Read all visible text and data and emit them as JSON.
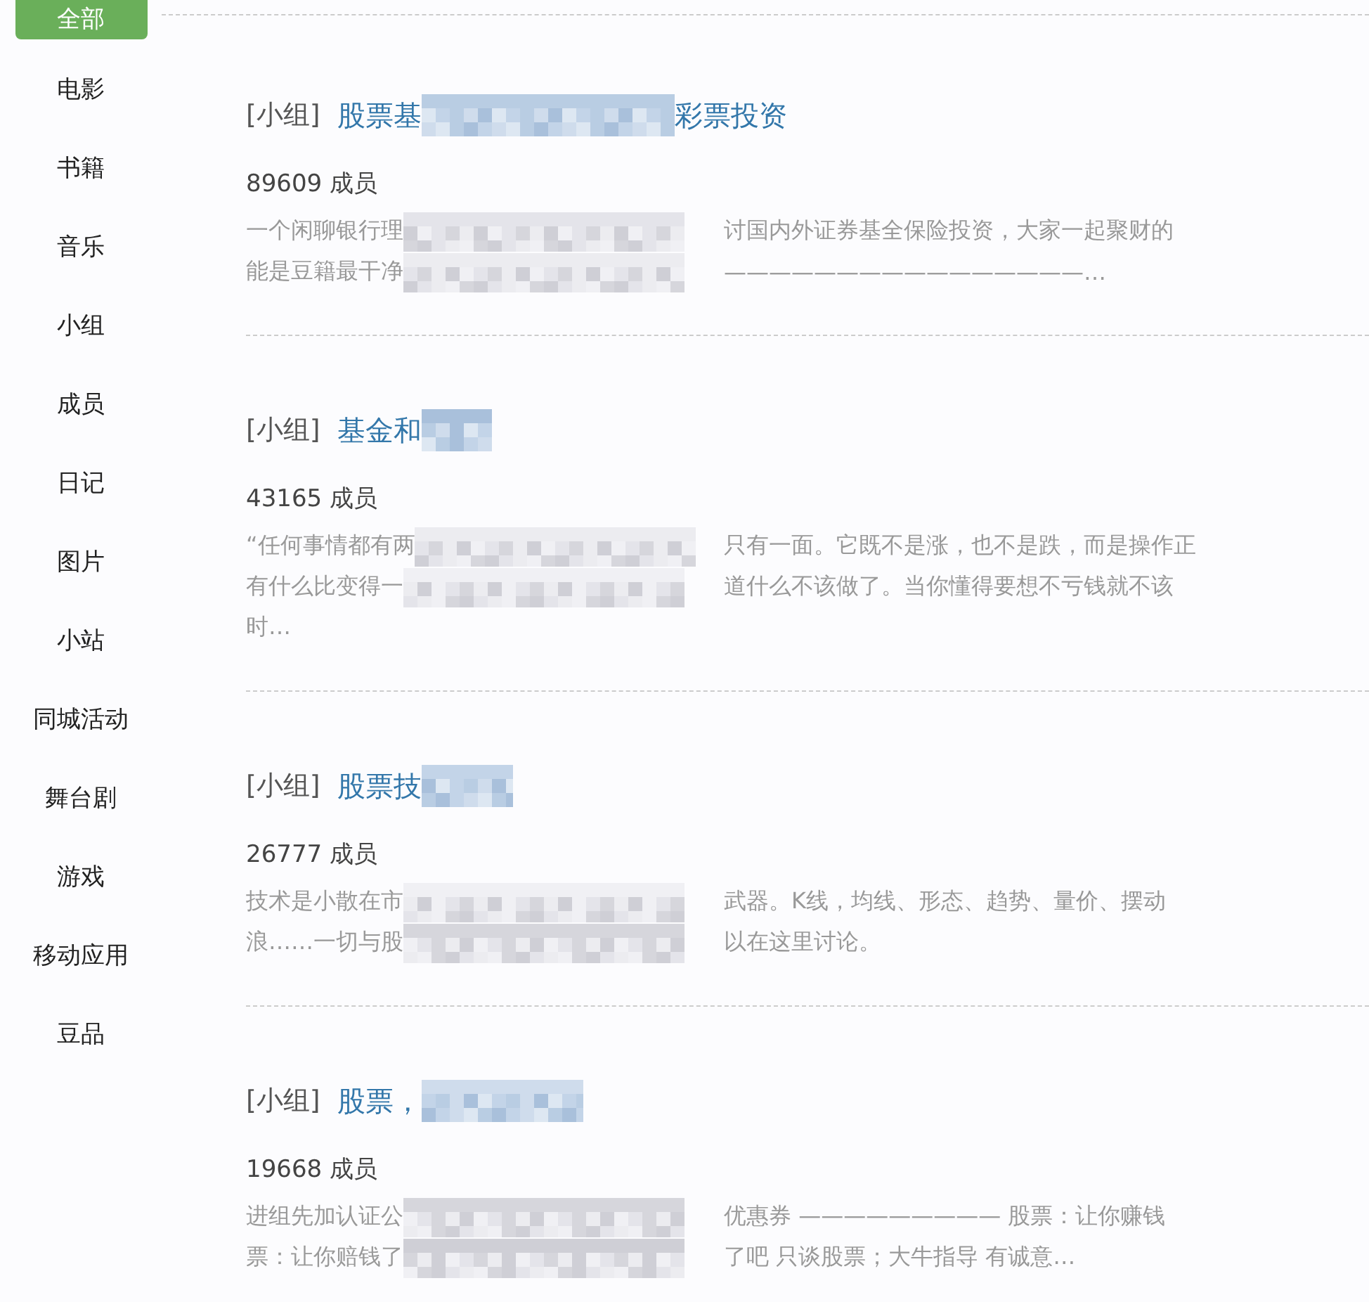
{
  "sidebar": {
    "items": [
      {
        "label": "全部",
        "selected": true
      },
      {
        "label": "电影",
        "selected": false
      },
      {
        "label": "书籍",
        "selected": false
      },
      {
        "label": "音乐",
        "selected": false
      },
      {
        "label": "小组",
        "selected": false
      },
      {
        "label": "成员",
        "selected": false
      },
      {
        "label": "日记",
        "selected": false
      },
      {
        "label": "图片",
        "selected": false
      },
      {
        "label": "小站",
        "selected": false
      },
      {
        "label": "同城活动",
        "selected": false
      },
      {
        "label": "舞台剧",
        "selected": false
      },
      {
        "label": "游戏",
        "selected": false
      },
      {
        "label": "移动应用",
        "selected": false
      },
      {
        "label": "豆品",
        "selected": false
      }
    ]
  },
  "results": [
    {
      "tag": "[小组]",
      "title_before": "股票基",
      "title_after": "彩票投资",
      "members": "89609 成员",
      "lines": [
        [
          "一个闲聊银行理",
          "讨国内外证券基全保险投资，大家一起聚财的"
        ],
        [
          "能是豆籍最干净",
          "————————————————…"
        ]
      ]
    },
    {
      "tag": "[小组]",
      "title_before": "基金和",
      "members": "43165 成员",
      "lines": [
        [
          "“任何事情都有两",
          "只有一面。它既不是涨，也不是跌，而是操作正"
        ],
        [
          "有什么比变得一",
          "道什么不该做了。当你懂得要想不亏钱就不该"
        ],
        [
          "时…"
        ]
      ]
    },
    {
      "tag": "[小组]",
      "title_before": "股票技",
      "members": "26777 成员",
      "lines": [
        [
          "技术是小散在市",
          "武器。K线，均线、形态、趋势、量价、摆动"
        ],
        [
          "浪……一切与股",
          "以在这里讨论。"
        ]
      ]
    },
    {
      "tag": "[小组]",
      "title_before": "股票，",
      "members": "19668 成员",
      "lines": [
        [
          "进组先加认证公",
          "优惠券 ————————— 股票：让你赚钱"
        ],
        [
          "票：让你赔钱了",
          "了吧 只谈股票；大牛指导 有诚意…"
        ]
      ]
    }
  ]
}
